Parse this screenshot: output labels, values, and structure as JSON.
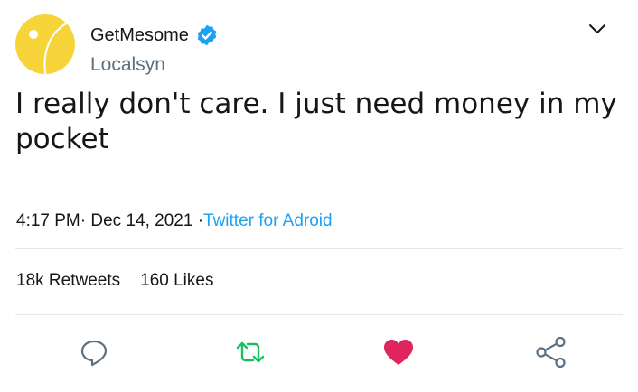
{
  "user": {
    "display_name": "GetMesome",
    "handle": "Localsyn",
    "verified": true,
    "avatar_icon": "yellow-ball-avatar",
    "avatar_color": "#f7d53a"
  },
  "tweet": {
    "text": "I really don't care. I just need money in my pocket",
    "time": "4:17 PM",
    "sep1": "·",
    "date": "Dec 14, 2021",
    "sep2": "·",
    "source": "Twitter for Adroid"
  },
  "stats": {
    "retweets_count": "18k",
    "retweets_label": "Retweets",
    "likes_count": "160",
    "likes_label": "Likes"
  },
  "actions": [
    {
      "name": "reply",
      "icon": "comment-icon"
    },
    {
      "name": "retweet",
      "icon": "retweet-icon",
      "color": "#17bf63"
    },
    {
      "name": "like",
      "icon": "heart-icon",
      "color": "#e0245e"
    },
    {
      "name": "share",
      "icon": "share-icon"
    }
  ],
  "colors": {
    "link": "#1da1f2",
    "secondary_text": "#5b7083",
    "divider": "#e1e8ed",
    "verified_badge": "#1da1f2"
  }
}
